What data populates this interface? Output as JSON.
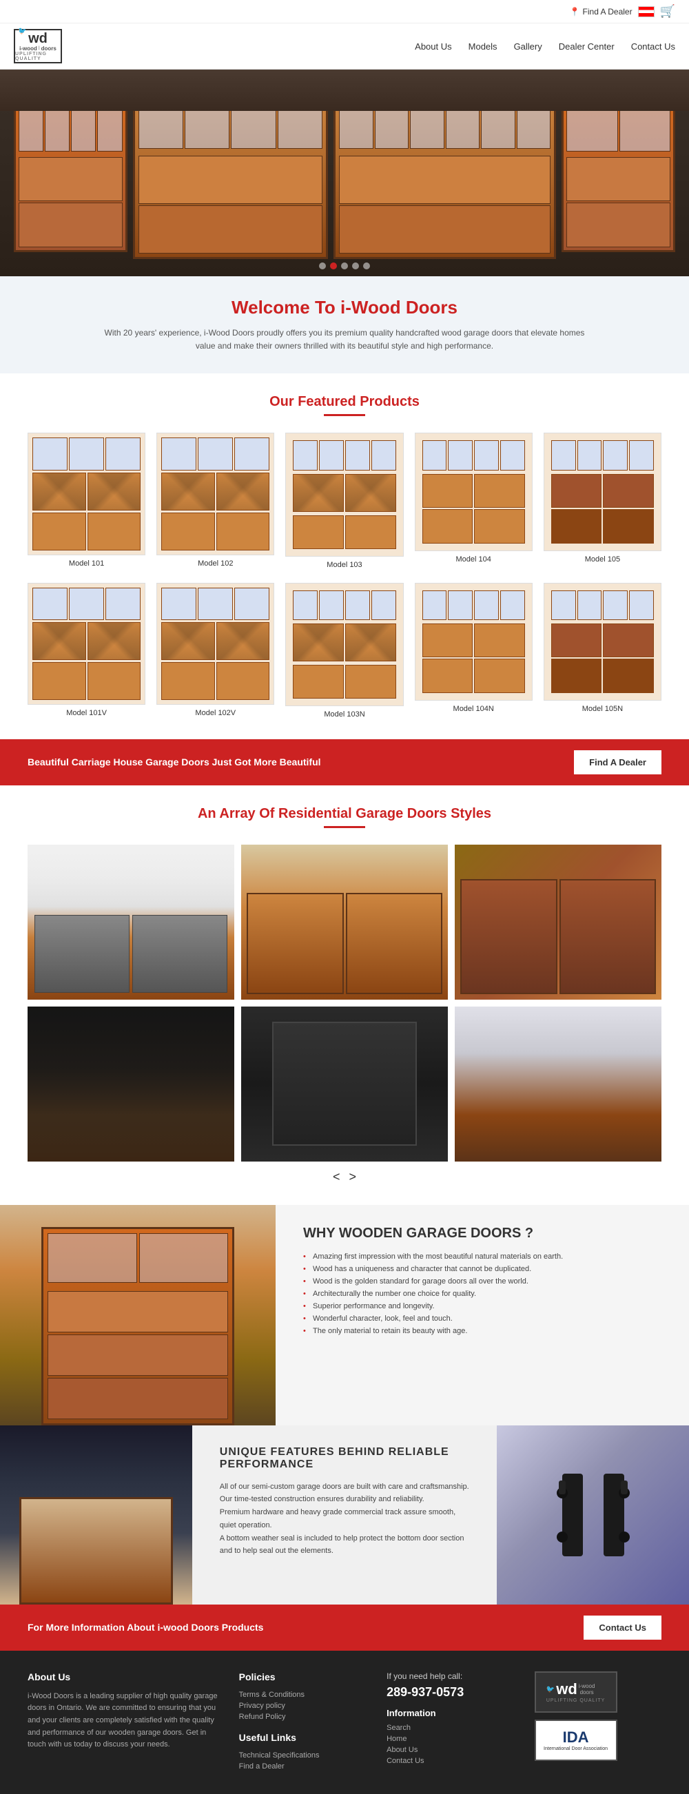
{
  "topbar": {
    "find_dealer": "Find A Dealer",
    "cart_icon": "🛒"
  },
  "nav": {
    "logo_wd": "wd",
    "logo_brand": "i-wood",
    "logo_sub": "doors",
    "logo_tag": "UPLIFTING QUALITY",
    "links": [
      {
        "label": "About Us",
        "id": "about-us"
      },
      {
        "label": "Models",
        "id": "models"
      },
      {
        "label": "Gallery",
        "id": "gallery"
      },
      {
        "label": "Dealer Center",
        "id": "dealer-center"
      },
      {
        "label": "Contact Us",
        "id": "contact-us"
      }
    ]
  },
  "hero": {
    "dots": [
      1,
      2,
      3,
      4,
      5
    ],
    "active_dot": 2
  },
  "welcome": {
    "title": "Welcome To i-Wood Doors",
    "text": "With 20 years' experience, i-Wood Doors proudly offers you its premium quality handcrafted wood garage doors that elevate homes value and make their owners thrilled with its beautiful style and high performance."
  },
  "featured": {
    "title": "Our Featured Products",
    "products_row1": [
      {
        "label": "Model 101",
        "id": "model-101"
      },
      {
        "label": "Model 102",
        "id": "model-102"
      },
      {
        "label": "Model 103",
        "id": "model-103"
      },
      {
        "label": "Model 104",
        "id": "model-104"
      },
      {
        "label": "Model 105",
        "id": "model-105"
      }
    ],
    "products_row2": [
      {
        "label": "Model 101V",
        "id": "model-101v"
      },
      {
        "label": "Model 102V",
        "id": "model-102v"
      },
      {
        "label": "Model 103N",
        "id": "model-103n"
      },
      {
        "label": "Model 104N",
        "id": "model-104n"
      },
      {
        "label": "Model 105N",
        "id": "model-105n"
      }
    ]
  },
  "red_banner": {
    "text": "Beautiful Carriage House Garage Doors Just Got More Beautiful",
    "button": "Find A Dealer"
  },
  "gallery": {
    "title": "An Array Of Residential Garage Doors Styles",
    "nav_prev": "<",
    "nav_next": ">"
  },
  "why": {
    "title": "WHY WOODEN GARAGE DOORS ?",
    "points": [
      "Amazing first impression with the most beautiful natural materials on earth.",
      "Wood has a uniqueness and character that cannot be duplicated.",
      "Wood is the golden standard for garage doors all over the world.",
      "Architecturally the number one choice for quality.",
      "Superior performance and longevity.",
      "Wonderful character, look, feel and touch.",
      "The only material to retain its beauty with age."
    ]
  },
  "features": {
    "title": "UNIQUE FEATURES BEHIND RELIABLE PERFORMANCE",
    "text": "All of our semi-custom garage doors are built with care and craftsmanship.\nOur time-tested construction ensures durability and reliability.\nPremium hardware and heavy grade commercial track assure smooth, quiet operation.\nA bottom weather seal is included to help protect the bottom door section and to help seal out the elements."
  },
  "contact_banner": {
    "text": "For More Information About i-wood Doors Products",
    "button": "Contact Us"
  },
  "footer": {
    "about_title": "About Us",
    "about_text": "i-Wood Doors is a leading supplier of high quality garage doors in Ontario. We are committed to ensuring that you and your clients are completely satisfied with the quality and performance of our wooden garage doors. Get in touch with us today to discuss your needs.",
    "policies_title": "Policies",
    "policies_links": [
      "Terms & Conditions",
      "Privacy policy",
      "Refund Policy"
    ],
    "useful_title": "Useful Links",
    "useful_links": [
      "Technical Specifications",
      "Find a Dealer"
    ],
    "help_label": "If you need help call:",
    "phone": "289-937-0573",
    "info_title": "Information",
    "info_links": [
      "Search",
      "Home",
      "About Us",
      "Contact Us"
    ],
    "logo_wd": "wd",
    "logo_brand": "i-wood",
    "logo_sub": "doors",
    "logo_tag": "UPLIFTING QUALITY",
    "ida_text": "IDA",
    "ida_sub": "International Door Association"
  }
}
